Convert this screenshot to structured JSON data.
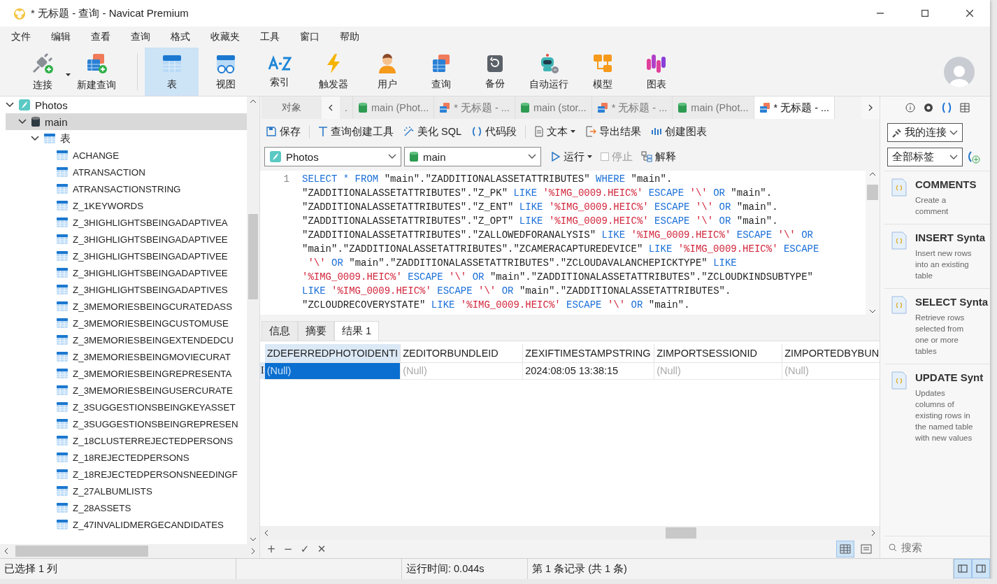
{
  "window": {
    "title": "* 无标题 - 查询 - Navicat Premium"
  },
  "menu": [
    "文件",
    "编辑",
    "查看",
    "查询",
    "格式",
    "收藏夹",
    "工具",
    "窗口",
    "帮助"
  ],
  "toolbar": [
    [
      {
        "label": "连接",
        "selected": false,
        "menu": true
      },
      {
        "label": "新建查询",
        "selected": false,
        "menu": false
      }
    ],
    [
      {
        "label": "表",
        "selected": true,
        "menu": false
      },
      {
        "label": "视图",
        "selected": false,
        "menu": false
      },
      {
        "label": "索引",
        "selected": false,
        "menu": false
      },
      {
        "label": "触发器",
        "selected": false,
        "menu": false
      },
      {
        "label": "用户",
        "selected": false,
        "menu": false
      },
      {
        "label": "查询",
        "selected": false,
        "menu": false
      },
      {
        "label": "备份",
        "selected": false,
        "menu": false
      },
      {
        "label": "自动运行",
        "selected": false,
        "menu": false
      },
      {
        "label": "模型",
        "selected": false,
        "menu": false
      },
      {
        "label": "图表",
        "selected": false,
        "menu": false
      }
    ]
  ],
  "tree": [
    {
      "label": "Photos",
      "kind": "connection",
      "expanded": true,
      "selected": false,
      "children": [
        {
          "label": "main",
          "kind": "database",
          "expanded": true,
          "selected": true,
          "children": [
            {
              "label": "表",
              "kind": "folder",
              "expanded": true,
              "selected": false,
              "children": [
                {
                  "label": "ACHANGE",
                  "kind": "table",
                  "selected": false
                },
                {
                  "label": "ATRANSACTION",
                  "kind": "table",
                  "selected": false
                },
                {
                  "label": "ATRANSACTIONSTRING",
                  "kind": "table",
                  "selected": false
                },
                {
                  "label": "Z_1KEYWORDS",
                  "kind": "table",
                  "selected": false
                },
                {
                  "label": "Z_3HIGHLIGHTSBEINGADAPTIVEA",
                  "kind": "table",
                  "selected": false
                },
                {
                  "label": "Z_3HIGHLIGHTSBEINGADAPTIVEE",
                  "kind": "table",
                  "selected": false
                },
                {
                  "label": "Z_3HIGHLIGHTSBEINGADAPTIVEE",
                  "kind": "table",
                  "selected": false
                },
                {
                  "label": "Z_3HIGHLIGHTSBEINGADAPTIVEE",
                  "kind": "table",
                  "selected": false
                },
                {
                  "label": "Z_3HIGHLIGHTSBEINGADAPTIVES",
                  "kind": "table",
                  "selected": false
                },
                {
                  "label": "Z_3MEMORIESBEINGCURATEDASS",
                  "kind": "table",
                  "selected": false
                },
                {
                  "label": "Z_3MEMORIESBEINGCUSTOMUSE",
                  "kind": "table",
                  "selected": false
                },
                {
                  "label": "Z_3MEMORIESBEINGEXTENDEDCU",
                  "kind": "table",
                  "selected": false
                },
                {
                  "label": "Z_3MEMORIESBEINGMOVIECURAT",
                  "kind": "table",
                  "selected": false
                },
                {
                  "label": "Z_3MEMORIESBEINGREPRESENTA",
                  "kind": "table",
                  "selected": false
                },
                {
                  "label": "Z_3MEMORIESBEINGUSERCURATE",
                  "kind": "table",
                  "selected": false
                },
                {
                  "label": "Z_3SUGGESTIONSBEINGKEYASSET",
                  "kind": "table",
                  "selected": false
                },
                {
                  "label": "Z_3SUGGESTIONSBEINGREPRESEN",
                  "kind": "table",
                  "selected": false
                },
                {
                  "label": "Z_18CLUSTERREJECTEDPERSONS",
                  "kind": "table",
                  "selected": false
                },
                {
                  "label": "Z_18REJECTEDPERSONS",
                  "kind": "table",
                  "selected": false
                },
                {
                  "label": "Z_18REJECTEDPERSONSNEEDINGF",
                  "kind": "table",
                  "selected": false
                },
                {
                  "label": "Z_27ALBUMLISTS",
                  "kind": "table",
                  "selected": false
                },
                {
                  "label": "Z_28ASSETS",
                  "kind": "table",
                  "selected": false
                },
                {
                  "label": "Z_47INVALIDMERGECANDIDATES",
                  "kind": "table",
                  "selected": false
                }
              ]
            }
          ]
        }
      ]
    }
  ],
  "object_tab": {
    "label": "对象",
    "selected": false
  },
  "tabs": [
    {
      "label": ".",
      "kind": "none",
      "selected": false
    },
    {
      "label": "main (Phot...",
      "kind": "database",
      "selected": false
    },
    {
      "label": "* 无标题 - ...",
      "kind": "query",
      "selected": false
    },
    {
      "label": "main (stor...",
      "kind": "database",
      "selected": false
    },
    {
      "label": "* 无标题 - ...",
      "kind": "query",
      "selected": false
    },
    {
      "label": "main (Phot...",
      "kind": "database",
      "selected": false
    },
    {
      "label": "* 无标题 - ...",
      "kind": "query",
      "selected": true
    }
  ],
  "query_toolbar": [
    {
      "label": "保存",
      "menu": false,
      "separator_before": false
    },
    {
      "label": "查询创建工具",
      "menu": false,
      "separator_before": true
    },
    {
      "label": "美化 SQL",
      "menu": false,
      "separator_before": false
    },
    {
      "label": "代码段",
      "menu": false,
      "separator_before": false
    },
    {
      "label": "文本",
      "menu": true,
      "separator_before": true
    },
    {
      "label": "导出结果",
      "menu": false,
      "separator_before": false
    },
    {
      "label": "创建图表",
      "menu": false,
      "separator_before": false
    }
  ],
  "connection_select": {
    "value": "Photos"
  },
  "database_select": {
    "value": "main"
  },
  "run_button": {
    "label": "运行",
    "menu": true
  },
  "stop_button": {
    "label": "停止",
    "disabled": true
  },
  "explain_button": {
    "label": "解释"
  },
  "editor": {
    "line_number": "1",
    "lines": [
      [
        {
          "kind": "kw",
          "t": "SELECT * FROM "
        },
        {
          "kind": "id",
          "t": "\"main\".\"ZADDITIONALASSETATTRIBUTES\" "
        },
        {
          "kind": "kw",
          "t": "WHERE "
        },
        {
          "kind": "id",
          "t": "\"main\"."
        }
      ],
      [
        {
          "kind": "id",
          "t": "\"ZADDITIONALASSETATTRIBUTES\".\"Z_PK\" "
        },
        {
          "kind": "kw",
          "t": "LIKE "
        },
        {
          "kind": "str",
          "t": "'%IMG_0009.HEIC%' "
        },
        {
          "kind": "kw",
          "t": "ESCAPE "
        },
        {
          "kind": "str",
          "t": "'\\' "
        },
        {
          "kind": "kw",
          "t": "OR "
        },
        {
          "kind": "id",
          "t": "\"main\"."
        }
      ],
      [
        {
          "kind": "id",
          "t": "\"ZADDITIONALASSETATTRIBUTES\".\"Z_ENT\" "
        },
        {
          "kind": "kw",
          "t": "LIKE "
        },
        {
          "kind": "str",
          "t": "'%IMG_0009.HEIC%' "
        },
        {
          "kind": "kw",
          "t": "ESCAPE "
        },
        {
          "kind": "str",
          "t": "'\\' "
        },
        {
          "kind": "kw",
          "t": "OR "
        },
        {
          "kind": "id",
          "t": "\"main\"."
        }
      ],
      [
        {
          "kind": "id",
          "t": "\"ZADDITIONALASSETATTRIBUTES\".\"Z_OPT\" "
        },
        {
          "kind": "kw",
          "t": "LIKE "
        },
        {
          "kind": "str",
          "t": "'%IMG_0009.HEIC%' "
        },
        {
          "kind": "kw",
          "t": "ESCAPE "
        },
        {
          "kind": "str",
          "t": "'\\' "
        },
        {
          "kind": "kw",
          "t": "OR "
        },
        {
          "kind": "id",
          "t": "\"main\"."
        }
      ],
      [
        {
          "kind": "id",
          "t": "\"ZADDITIONALASSETATTRIBUTES\".\"ZALLOWEDFORANALYSIS\" "
        },
        {
          "kind": "kw",
          "t": "LIKE "
        },
        {
          "kind": "str",
          "t": "'%IMG_0009.HEIC%' "
        },
        {
          "kind": "kw",
          "t": "ESCAPE "
        },
        {
          "kind": "str",
          "t": "'\\' "
        },
        {
          "kind": "kw",
          "t": "OR"
        }
      ],
      [
        {
          "kind": "id",
          "t": "\"main\".\"ZADDITIONALASSETATTRIBUTES\".\"ZCAMERACAPTUREDEVICE\" "
        },
        {
          "kind": "kw",
          "t": "LIKE "
        },
        {
          "kind": "str",
          "t": "'%IMG_0009.HEIC%' "
        },
        {
          "kind": "kw",
          "t": "ESCAPE"
        }
      ],
      [
        {
          "kind": "str",
          "t": " '\\' "
        },
        {
          "kind": "kw",
          "t": "OR "
        },
        {
          "kind": "id",
          "t": "\"main\".\"ZADDITIONALASSETATTRIBUTES\".\"ZCLOUDAVALANCHEPICKTYPE\" "
        },
        {
          "kind": "kw",
          "t": "LIKE"
        }
      ],
      [
        {
          "kind": "str",
          "t": "'%IMG_0009.HEIC%' "
        },
        {
          "kind": "kw",
          "t": "ESCAPE "
        },
        {
          "kind": "str",
          "t": "'\\' "
        },
        {
          "kind": "kw",
          "t": "OR "
        },
        {
          "kind": "id",
          "t": "\"main\".\"ZADDITIONALASSETATTRIBUTES\".\"ZCLOUDKINDSUBTYPE\""
        }
      ],
      [
        {
          "kind": "kw",
          "t": "LIKE "
        },
        {
          "kind": "str",
          "t": "'%IMG_0009.HEIC%' "
        },
        {
          "kind": "kw",
          "t": "ESCAPE "
        },
        {
          "kind": "str",
          "t": "'\\' "
        },
        {
          "kind": "kw",
          "t": "OR "
        },
        {
          "kind": "id",
          "t": "\"main\".\"ZADDITIONALASSETATTRIBUTES\"."
        }
      ],
      [
        {
          "kind": "id",
          "t": "\"ZCLOUDRECOVERYSTATE\" "
        },
        {
          "kind": "kw",
          "t": "LIKE "
        },
        {
          "kind": "str",
          "t": "'%IMG_0009.HEIC%' "
        },
        {
          "kind": "kw",
          "t": "ESCAPE "
        },
        {
          "kind": "str",
          "t": "'\\' "
        },
        {
          "kind": "kw",
          "t": "OR "
        },
        {
          "kind": "id",
          "t": "\"main\"."
        }
      ]
    ]
  },
  "result_tabs": [
    {
      "label": "信息",
      "selected": false
    },
    {
      "label": "摘要",
      "selected": false
    },
    {
      "label": "结果 1",
      "selected": true
    }
  ],
  "grid": {
    "columns": [
      "ZDEFERREDPHOTOIDENTI",
      "ZEDITORBUNDLEID",
      "ZEXIFTIMESTAMPSTRING",
      "ZIMPORTSESSIONID",
      "ZIMPORTEDBYBUN"
    ],
    "rows": [
      {
        "marker": "I",
        "cells": [
          {
            "text": "(Null)",
            "null": true,
            "selected": true
          },
          {
            "text": "(Null)",
            "null": true,
            "selected": false
          },
          {
            "text": "2024:08:05 13:38:15",
            "null": false,
            "selected": false
          },
          {
            "text": "(Null)",
            "null": true,
            "selected": false
          },
          {
            "text": "(Null)",
            "null": true,
            "selected": false
          }
        ]
      }
    ]
  },
  "grid_actions": [
    "+",
    "−",
    "✓",
    "✕"
  ],
  "view_toggles": [
    {
      "selected": true
    },
    {
      "selected": false
    }
  ],
  "side_panel": {
    "tabs": [
      {
        "selected": false
      },
      {
        "selected": false
      },
      {
        "selected": true
      },
      {
        "selected": false
      }
    ],
    "connection_dropdown": {
      "value": "我的连接"
    },
    "tag_select": {
      "value": "全部标签"
    },
    "snippets": [
      {
        "title": "COMMENTS",
        "description": "Create a comment"
      },
      {
        "title": "INSERT Synta",
        "description": "Insert new rows into an existing table"
      },
      {
        "title": "SELECT Synta",
        "description": "Retrieve rows selected from one or more tables"
      },
      {
        "title": "UPDATE Synt",
        "description": "Updates columns of existing rows in the named table with new values"
      }
    ],
    "search": {
      "placeholder": "搜索"
    }
  },
  "status_bar": {
    "selection": "已选择 1 列",
    "run_time": "运行时间: 0.044s",
    "record": "第 1 条记录 (共 1 条)",
    "layout_toggles": [
      {
        "selected": true
      },
      {
        "selected": true
      }
    ]
  }
}
